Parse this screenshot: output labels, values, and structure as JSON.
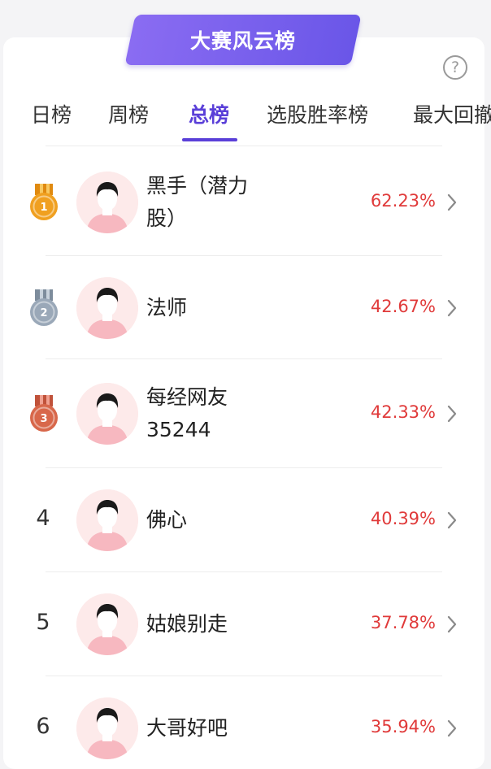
{
  "banner": {
    "title": "大赛风云榜"
  },
  "help": {
    "glyph": "?"
  },
  "tabs": [
    {
      "label": "日榜",
      "active": false
    },
    {
      "label": "周榜",
      "active": false
    },
    {
      "label": "总榜",
      "active": true
    },
    {
      "label": "选股胜率榜",
      "active": false
    },
    {
      "label": "最大回撤",
      "active": false
    }
  ],
  "rankings": [
    {
      "rank": "1",
      "medal": "gold",
      "name": "黑手（潜力股）",
      "rate": "62.23%"
    },
    {
      "rank": "2",
      "medal": "silver",
      "name": "法师",
      "rate": "42.67%"
    },
    {
      "rank": "3",
      "medal": "bronze",
      "name": "每经网友35244",
      "rate": "42.33%"
    },
    {
      "rank": "4",
      "medal": null,
      "name": "佛心",
      "rate": "40.39%"
    },
    {
      "rank": "5",
      "medal": null,
      "name": "姑娘别走",
      "rate": "37.78%"
    },
    {
      "rank": "6",
      "medal": null,
      "name": "大哥好吧",
      "rate": "35.94%"
    }
  ],
  "colors": {
    "accent": "#5a3fd8",
    "rate": "#e03a3a",
    "gold": "#f0a020",
    "silver": "#9aa8b8",
    "bronze": "#d8674a"
  }
}
